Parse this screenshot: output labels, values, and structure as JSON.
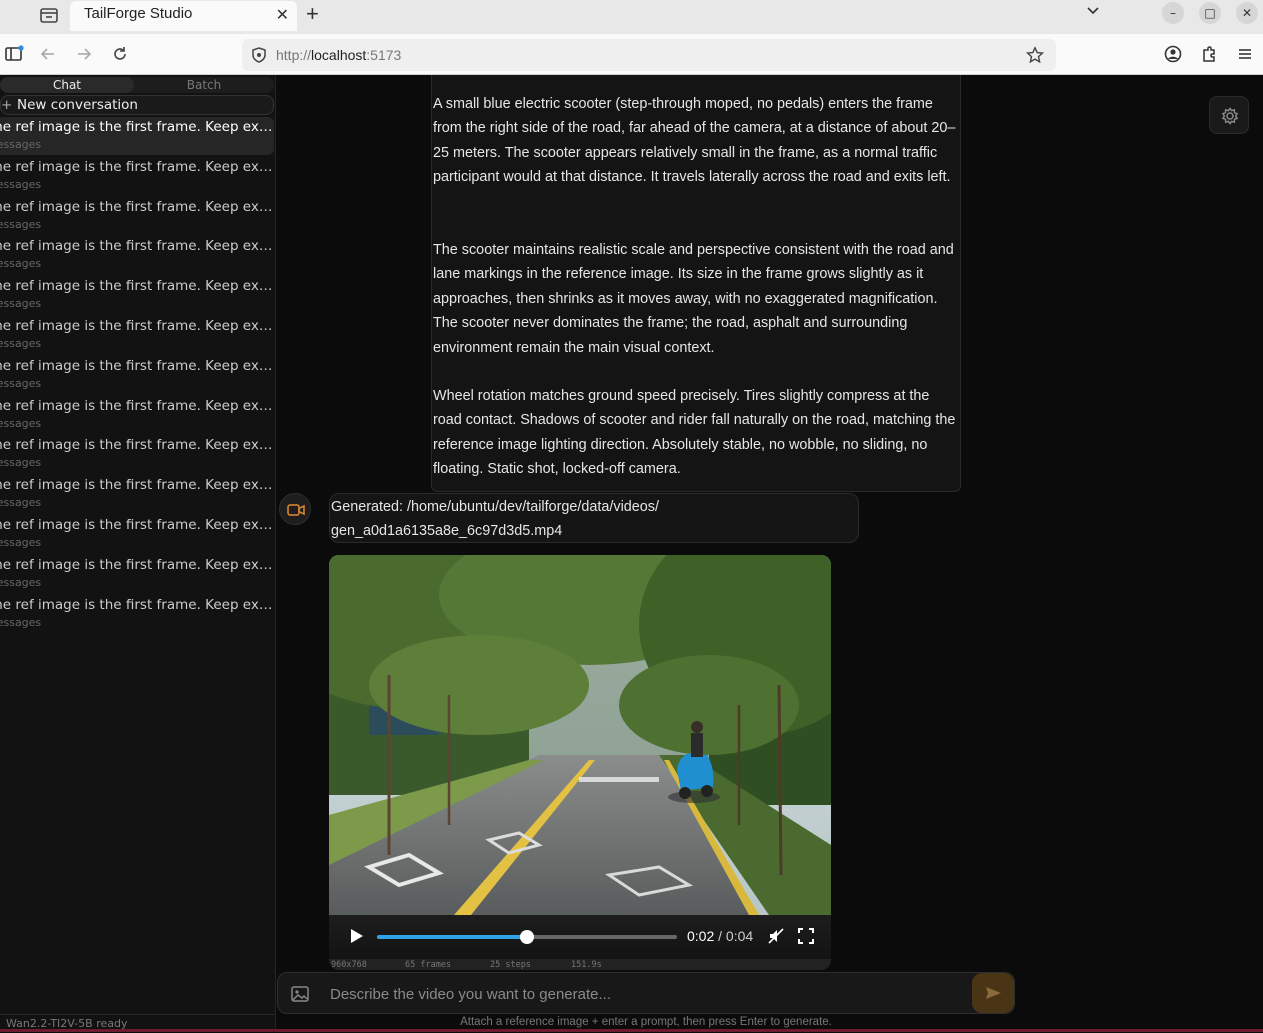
{
  "browser": {
    "tab_title": "TailForge Studio",
    "url_prefix": "http://",
    "url_host": "localhost",
    "url_port": ":5173"
  },
  "sidebar": {
    "tabs": [
      {
        "label": "Chat",
        "active": true
      },
      {
        "label": "Batch",
        "active": false
      }
    ],
    "new_conversation": "New conversation",
    "conversations": [
      {
        "title": "The ref image is the first frame. Keep exactly the same scene...",
        "meta": "messages",
        "active": true
      },
      {
        "title": "The ref image is the first frame. Keep exactly the same scene...",
        "meta": "messages"
      },
      {
        "title": "The ref image is the first frame. Keep exactly the same scene...",
        "meta": "messages"
      },
      {
        "title": "The ref image is the first frame. Keep exactly the same scene...",
        "meta": "messages"
      },
      {
        "title": "The ref image is the first frame. Keep exactly the same scene...",
        "meta": "messages"
      },
      {
        "title": "The ref image is the first frame. Keep exactly the same scene...",
        "meta": "messages"
      },
      {
        "title": "The ref image is the first frame. Keep exactly the same scene...",
        "meta": "messages"
      },
      {
        "title": "The ref image is the first frame. Keep exactly the same scene...",
        "meta": "messages"
      },
      {
        "title": "The ref image is the first frame. Keep exactly the same scene...",
        "meta": "messages"
      },
      {
        "title": "The ref image is the first frame. Keep exactly the same scene...",
        "meta": "messages"
      },
      {
        "title": "The ref image is the first frame. Keep exactly the same scene...",
        "meta": "messages"
      },
      {
        "title": "The ref image is the first frame. Keep exactly the same scene...",
        "meta": "messages"
      },
      {
        "title": "The ref image is the first frame. Keep exactly the same scene...",
        "meta": "messages"
      }
    ],
    "status": "Wan2.2-TI2V-5B ready"
  },
  "chat": {
    "prompt_paragraphs": [
      "A small blue electric scooter (step-through moped, no pedals) enters the frame from the right side of the road, far ahead of the camera, at a distance of about 20–25 meters. The scooter appears relatively small in the frame, as a normal traffic participant would at that distance. It travels laterally across the road and exits left.",
      "The scooter maintains realistic scale and perspective consistent with the road and lane markings in the reference image. Its size in the frame grows slightly as it approaches, then shrinks as it moves away, with no exaggerated magnification. The scooter never dominates the frame; the road, asphalt and surrounding environment remain the main visual context.",
      "Wheel rotation matches ground speed precisely. Tires slightly compress at the road contact. Shadows of scooter and rider fall naturally on the road, matching the reference image lighting direction. Absolutely stable, no wobble, no sliding, no floating. Static shot, locked-off camera."
    ],
    "generated_label": "Generated: /home/ubuntu/dev/tailforge/data/videos/",
    "generated_file": "gen_a0d1a6135a8e_6c97d3d5.mp4",
    "video": {
      "current_time": "0:02",
      "separator": " / ",
      "duration": "0:04",
      "progress": 0.5
    },
    "meta": {
      "resolution": "960x768",
      "frames": "65 frames",
      "steps": "25 steps",
      "time": "151.9s"
    }
  },
  "composer": {
    "placeholder": "Describe the video you want to generate...",
    "hint": "Attach a reference image + enter a prompt, then press Enter to generate."
  },
  "colors": {
    "accent": "#2fa3e6",
    "send_button": "#4a3416",
    "background": "#0b0b0b"
  }
}
